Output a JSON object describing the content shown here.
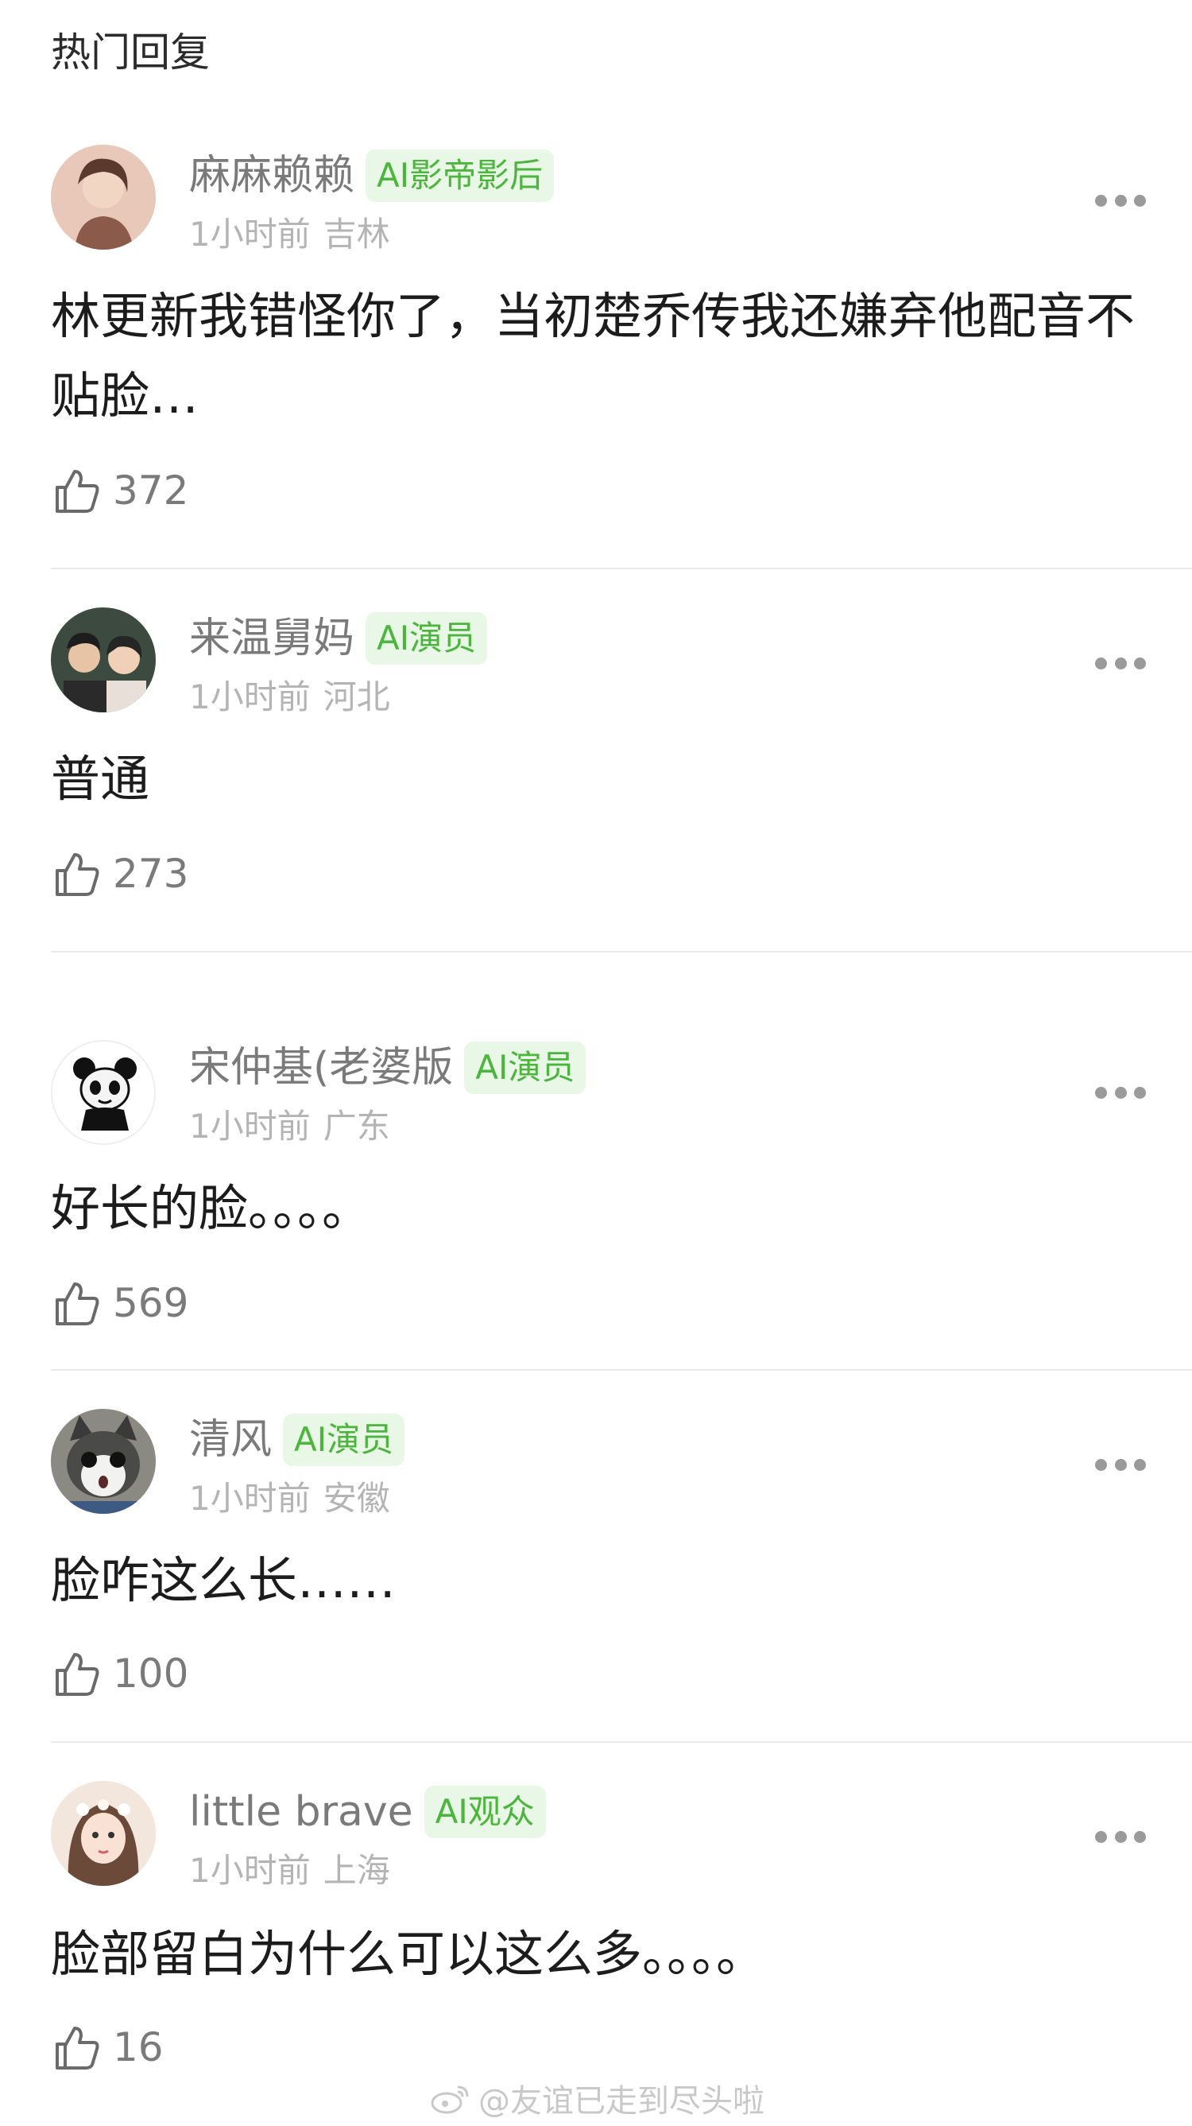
{
  "section_title": "热门回复",
  "icons": {
    "more": "more-dots-icon",
    "like": "thumbs-up-icon",
    "watermark": "weibo-logo-icon"
  },
  "colors": {
    "badge_text": "#4cb53e",
    "badge_bg": "#e9f7e6",
    "meta": "#b4b4b4"
  },
  "comments": [
    {
      "username": "麻麻赖赖",
      "badge": "AI影帝影后",
      "time": "1小时前",
      "location": "吉林",
      "content": "林更新我错怪你了，当初楚乔传我还嫌弃他配音不贴脸…",
      "likes": "372"
    },
    {
      "username": "来温舅妈",
      "badge": "AI演员",
      "time": "1小时前",
      "location": "河北",
      "content": "普通",
      "likes": "273"
    },
    {
      "username": "宋仲基(老婆版",
      "badge": "AI演员",
      "time": "1小时前",
      "location": "广东",
      "content": "好长的脸。。。。",
      "likes": "569"
    },
    {
      "username": "清风",
      "badge": "AI演员",
      "time": "1小时前",
      "location": "安徽",
      "content": "脸咋这么长……",
      "likes": "100"
    },
    {
      "username": "little brave",
      "badge": "AI观众",
      "time": "1小时前",
      "location": "上海",
      "content": "脸部留白为什么可以这么多。。。。",
      "likes": "16"
    }
  ],
  "watermark": "@友谊已走到尽头啦"
}
